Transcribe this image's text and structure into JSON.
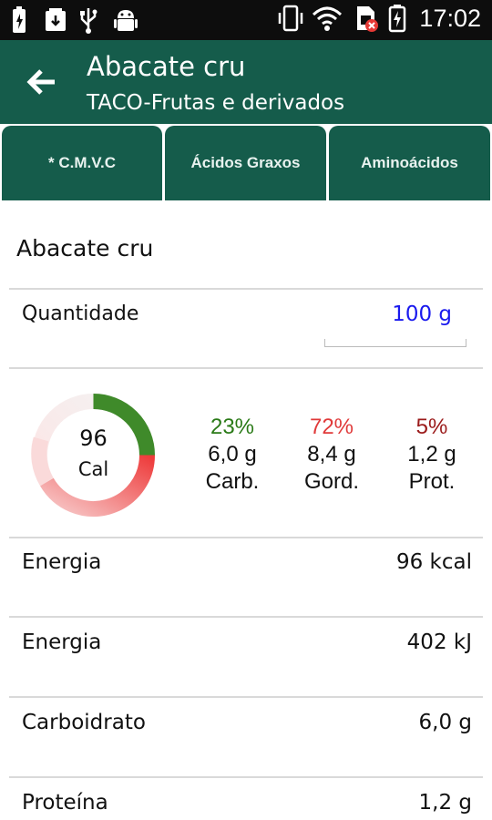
{
  "status_bar": {
    "time": "17:02"
  },
  "header": {
    "title": "Abacate cru",
    "subtitle": "TACO-Frutas e derivados"
  },
  "tabs": [
    {
      "label": "* C.M.V.C",
      "active": true
    },
    {
      "label": "Ácidos Graxos",
      "active": false
    },
    {
      "label": "Aminoácidos",
      "active": false
    }
  ],
  "food_name": "Abacate cru",
  "quantity": {
    "label": "Quantidade",
    "value": "100 g"
  },
  "calories": {
    "value": "96",
    "unit": "Cal"
  },
  "macros": [
    {
      "percent": "23%",
      "amount": "6,0 g",
      "label": "Carb.",
      "color": "#2a7a17"
    },
    {
      "percent": "72%",
      "amount": "8,4 g",
      "label": "Gord.",
      "color": "#e03a3a"
    },
    {
      "percent": "5%",
      "amount": "1,2 g",
      "label": "Prot.",
      "color": "#9b1b1b"
    }
  ],
  "nutrients": [
    {
      "label": "Energia",
      "value": "96 kcal"
    },
    {
      "label": "Energia",
      "value": "402 kJ"
    },
    {
      "label": "Carboidrato",
      "value": "6,0 g"
    },
    {
      "label": "Proteína",
      "value": "1,2 g"
    }
  ]
}
